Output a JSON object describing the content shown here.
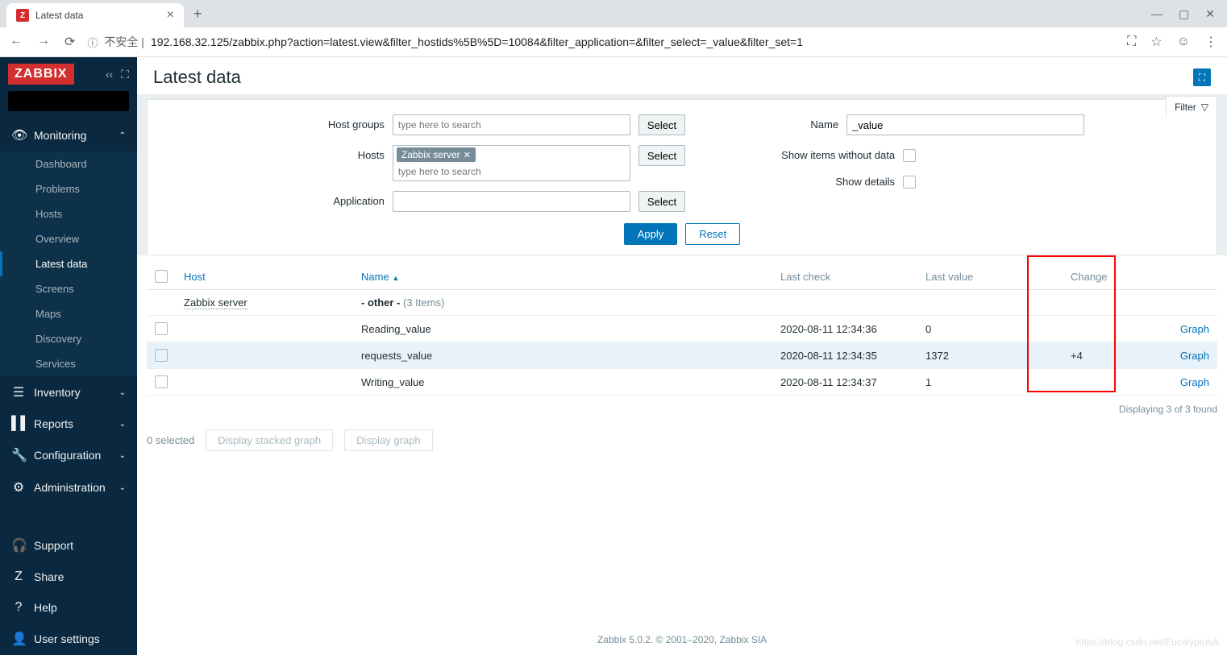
{
  "browser": {
    "tab_title": "Latest data",
    "url_prefix": "不安全 |",
    "url": "192.168.32.125/zabbix.php?action=latest.view&filter_hostids%5B%5D=10084&filter_application=&filter_select=_value&filter_set=1"
  },
  "logo": "ZABBIX",
  "page_title": "Latest data",
  "nav": {
    "monitoring": {
      "label": "Monitoring",
      "items": [
        "Dashboard",
        "Problems",
        "Hosts",
        "Overview",
        "Latest data",
        "Screens",
        "Maps",
        "Discovery",
        "Services"
      ]
    },
    "inventory": "Inventory",
    "reports": "Reports",
    "configuration": "Configuration",
    "administration": "Administration",
    "support": "Support",
    "share": "Share",
    "help": "Help",
    "user_settings": "User settings"
  },
  "filter": {
    "tab_label": "Filter",
    "labels": {
      "host_groups": "Host groups",
      "hosts": "Hosts",
      "application": "Application",
      "name": "Name",
      "show_without_data": "Show items without data",
      "show_details": "Show details"
    },
    "placeholder": "type here to search",
    "host_tag": "Zabbix server",
    "name_value": "_value",
    "select_btn": "Select",
    "apply": "Apply",
    "reset": "Reset"
  },
  "table": {
    "headers": {
      "host": "Host",
      "name": "Name",
      "last_check": "Last check",
      "last_value": "Last value",
      "change": "Change"
    },
    "group_host": "Zabbix server",
    "group_label": "- other -",
    "group_count": "(3 Items)",
    "rows": [
      {
        "name": "Reading_value",
        "last_check": "2020-08-11 12:34:36",
        "last_value": "0",
        "change": "",
        "action": "Graph"
      },
      {
        "name": "requests_value",
        "last_check": "2020-08-11 12:34:35",
        "last_value": "1372",
        "change": "+4",
        "action": "Graph",
        "highlight": true
      },
      {
        "name": "Writing_value",
        "last_check": "2020-08-11 12:34:37",
        "last_value": "1",
        "change": "",
        "action": "Graph"
      }
    ],
    "footer": "Displaying 3 of 3 found"
  },
  "selection": {
    "text": "0 selected",
    "stacked": "Display stacked graph",
    "graph": "Display graph"
  },
  "footer": "Zabbix 5.0.2. © 2001–2020, Zabbix SIA",
  "watermark": "https://blog.csdn.net/EucalyptusA"
}
